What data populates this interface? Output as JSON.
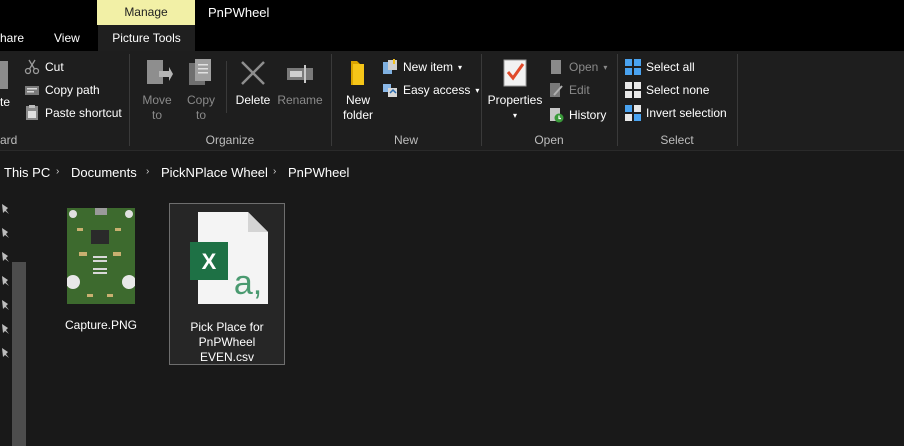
{
  "window": {
    "context_tab": "Manage",
    "title": "PnPWheel"
  },
  "tabs": {
    "share": "hare",
    "view": "View",
    "picture_tools": "Picture Tools"
  },
  "ribbon": {
    "clipboard": {
      "label": "ard",
      "paste_partial": "te",
      "cut": "Cut",
      "copy_path": "Copy path",
      "paste_shortcut": "Paste shortcut"
    },
    "organize": {
      "label": "Organize",
      "move_to": "Move",
      "move_to_2": "to",
      "copy_to": "Copy",
      "copy_to_2": "to",
      "delete": "Delete",
      "rename": "Rename"
    },
    "new": {
      "label": "New",
      "new_folder": "New",
      "new_folder_2": "folder",
      "new_item": "New item",
      "easy_access": "Easy access"
    },
    "open": {
      "label": "Open",
      "properties": "Properties",
      "open": "Open",
      "edit": "Edit",
      "history": "History"
    },
    "select": {
      "label": "Select",
      "select_all": "Select all",
      "select_none": "Select none",
      "invert_selection": "Invert selection"
    }
  },
  "breadcrumb": [
    "This PC",
    "Documents",
    "PickNPlace Wheel",
    "PnPWheel"
  ],
  "files": [
    {
      "name": "Capture.PNG",
      "selected": false
    },
    {
      "name": "Pick Place for PnPWheel EVEN.csv",
      "selected": true
    }
  ],
  "colors": {
    "manage_tab": "#f2f0a6",
    "ribbon_bg": "#1e1e1e",
    "content_bg": "#191919",
    "excel_green": "#1e7145"
  }
}
